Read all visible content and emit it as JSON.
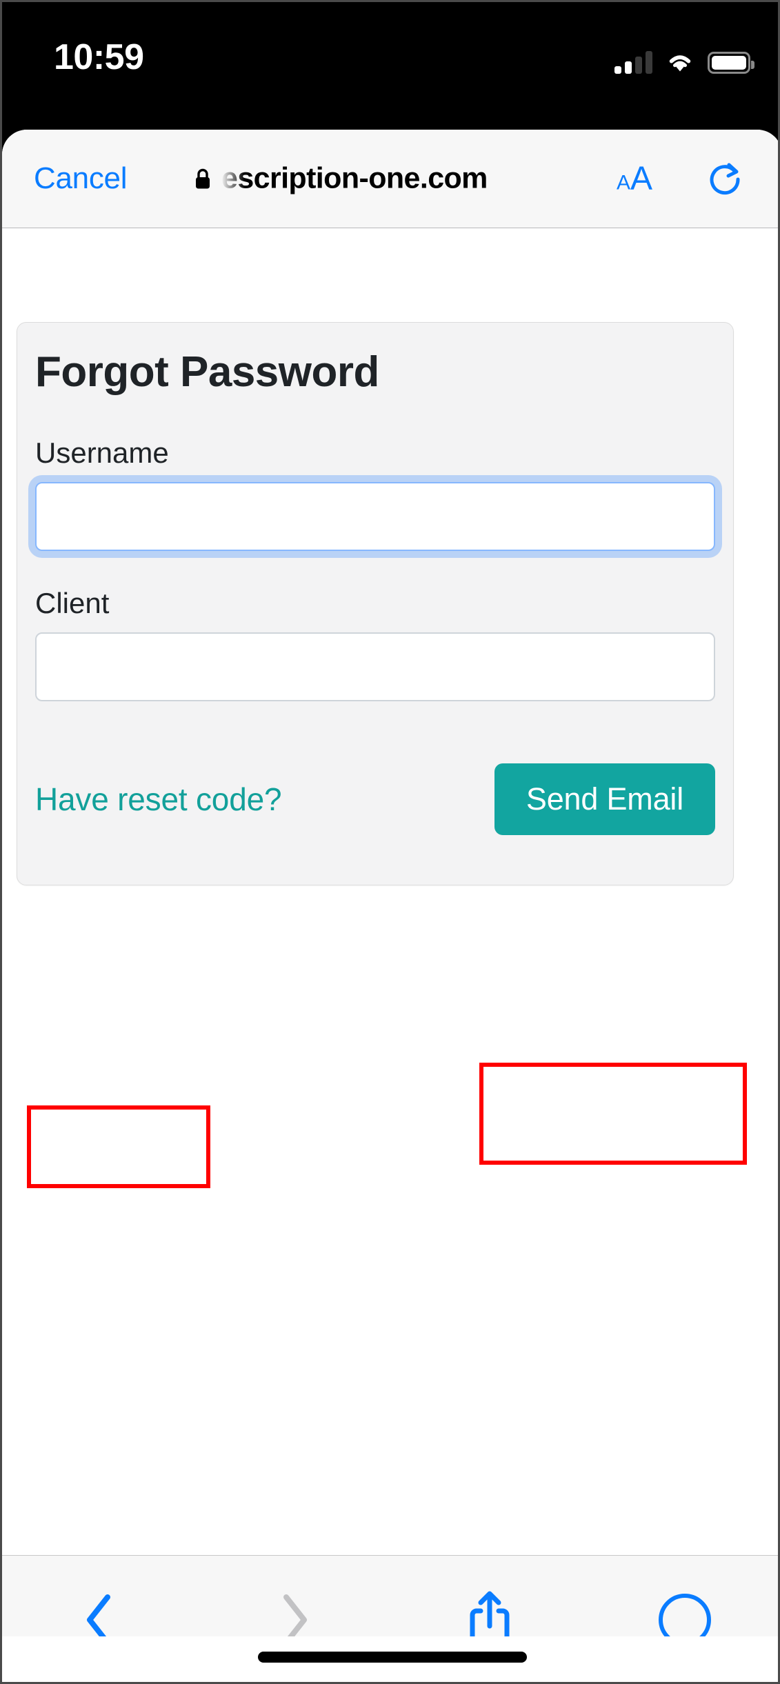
{
  "status_bar": {
    "time": "10:59",
    "signal_icon": "cellular-signal-icon",
    "wifi_icon": "wifi-icon",
    "battery_icon": "battery-icon",
    "signal_bars_filled": 2,
    "signal_bars_total": 4
  },
  "browser": {
    "cancel_label": "Cancel",
    "lock_icon": "lock-icon",
    "url": "escription-one.com",
    "url_truncated_prefix": true,
    "text_size_small": "A",
    "text_size_large": "A",
    "reload_icon": "reload-icon",
    "accent_color": "#0a7cff"
  },
  "page": {
    "card": {
      "title": "Forgot Password",
      "fields": [
        {
          "label": "Username",
          "value": "",
          "placeholder": "",
          "focused": true
        },
        {
          "label": "Client",
          "value": "",
          "placeholder": "",
          "focused": false
        }
      ],
      "reset_link_label": "Have reset code?",
      "submit_label": "Send Email",
      "link_color": "#12a09a",
      "button_color": "#12a5a0",
      "card_background": "#f3f3f4",
      "title_color": "#1f2327"
    }
  },
  "annotations": {
    "highlight_color": "#ff0000",
    "boxes": [
      {
        "name": "have-reset-code-highlight",
        "target": "Have reset code?"
      },
      {
        "name": "send-email-highlight",
        "target": "Send Email"
      }
    ]
  },
  "toolbar": {
    "items": [
      {
        "name": "back-button",
        "icon": "chevron-left-icon",
        "enabled": true
      },
      {
        "name": "forward-button",
        "icon": "chevron-right-icon",
        "enabled": false
      },
      {
        "name": "share-button",
        "icon": "share-icon",
        "enabled": true
      },
      {
        "name": "tabs-button",
        "icon": "compass-icon",
        "enabled": true
      }
    ],
    "enabled_color": "#0a7cff",
    "disabled_color": "#c2c2c4"
  }
}
